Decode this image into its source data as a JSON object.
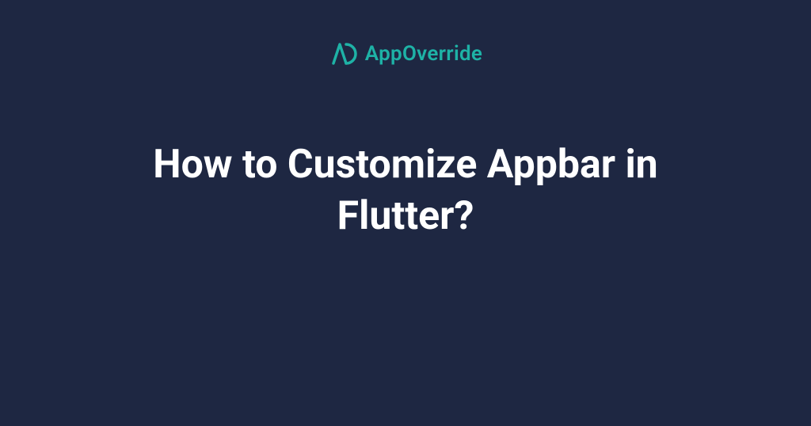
{
  "brand": {
    "name": "AppOverride",
    "accent_color": "#1eb2a6"
  },
  "background_color": "#1e2742",
  "headline": "How to Customize Appbar in Flutter?"
}
